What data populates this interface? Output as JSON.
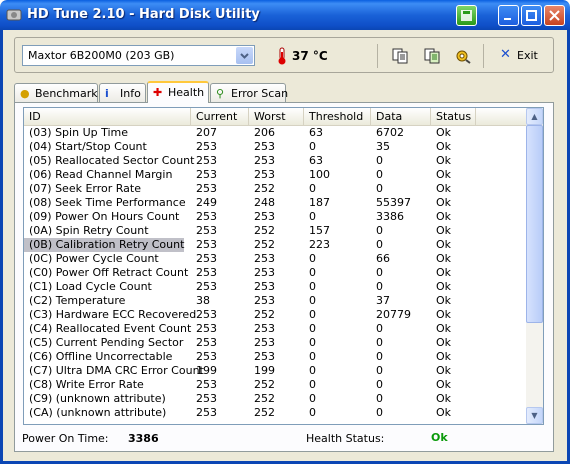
{
  "window": {
    "title": "HD Tune 2.10 - Hard Disk Utility"
  },
  "toolbar": {
    "drive": "Maxtor 6B200M0 (203 GB)",
    "temperature": "37 °C",
    "exit_label": "Exit",
    "icons": [
      "copy-icon",
      "copy-screenshot-icon",
      "options-icon"
    ]
  },
  "tabs": [
    {
      "label": "Benchmark",
      "icon": "bulb-icon"
    },
    {
      "label": "Info",
      "icon": "info-icon"
    },
    {
      "label": "Health",
      "icon": "red-cross-icon",
      "active": true
    },
    {
      "label": "Error Scan",
      "icon": "magnifier-icon"
    }
  ],
  "table": {
    "columns": [
      "ID",
      "Current",
      "Worst",
      "Threshold",
      "Data",
      "Status"
    ],
    "rows": [
      [
        "(03) Spin Up Time",
        "207",
        "206",
        "63",
        "6702",
        "Ok"
      ],
      [
        "(04) Start/Stop Count",
        "253",
        "253",
        "0",
        "35",
        "Ok"
      ],
      [
        "(05) Reallocated Sector Count",
        "253",
        "253",
        "63",
        "0",
        "Ok"
      ],
      [
        "(06) Read Channel Margin",
        "253",
        "253",
        "100",
        "0",
        "Ok"
      ],
      [
        "(07) Seek Error Rate",
        "253",
        "252",
        "0",
        "0",
        "Ok"
      ],
      [
        "(08) Seek Time Performance",
        "249",
        "248",
        "187",
        "55397",
        "Ok"
      ],
      [
        "(09) Power On Hours Count",
        "253",
        "253",
        "0",
        "3386",
        "Ok"
      ],
      [
        "(0A) Spin Retry Count",
        "253",
        "252",
        "157",
        "0",
        "Ok"
      ],
      [
        "(0B) Calibration Retry Count",
        "253",
        "252",
        "223",
        "0",
        "Ok"
      ],
      [
        "(0C) Power Cycle Count",
        "253",
        "253",
        "0",
        "66",
        "Ok"
      ],
      [
        "(C0) Power Off Retract Count",
        "253",
        "253",
        "0",
        "0",
        "Ok"
      ],
      [
        "(C1) Load Cycle Count",
        "253",
        "253",
        "0",
        "0",
        "Ok"
      ],
      [
        "(C2) Temperature",
        "38",
        "253",
        "0",
        "37",
        "Ok"
      ],
      [
        "(C3) Hardware ECC Recovered",
        "253",
        "252",
        "0",
        "20779",
        "Ok"
      ],
      [
        "(C4) Reallocated Event Count",
        "253",
        "253",
        "0",
        "0",
        "Ok"
      ],
      [
        "(C5) Current Pending Sector",
        "253",
        "253",
        "0",
        "0",
        "Ok"
      ],
      [
        "(C6) Offline Uncorrectable",
        "253",
        "253",
        "0",
        "0",
        "Ok"
      ],
      [
        "(C7) Ultra DMA CRC Error Count",
        "199",
        "199",
        "0",
        "0",
        "Ok"
      ],
      [
        "(C8) Write Error Rate",
        "253",
        "252",
        "0",
        "0",
        "Ok"
      ],
      [
        "(C9) (unknown attribute)",
        "253",
        "252",
        "0",
        "0",
        "Ok"
      ],
      [
        "(CA) (unknown attribute)",
        "253",
        "252",
        "0",
        "0",
        "Ok"
      ]
    ],
    "selected_row": 8
  },
  "status": {
    "power_on_label": "Power On Time:",
    "power_on_value": "3386",
    "health_label": "Health Status:",
    "health_value": "Ok"
  },
  "colors": {
    "accent": "#0a5fe0",
    "health_ok": "#0a9a0a"
  }
}
